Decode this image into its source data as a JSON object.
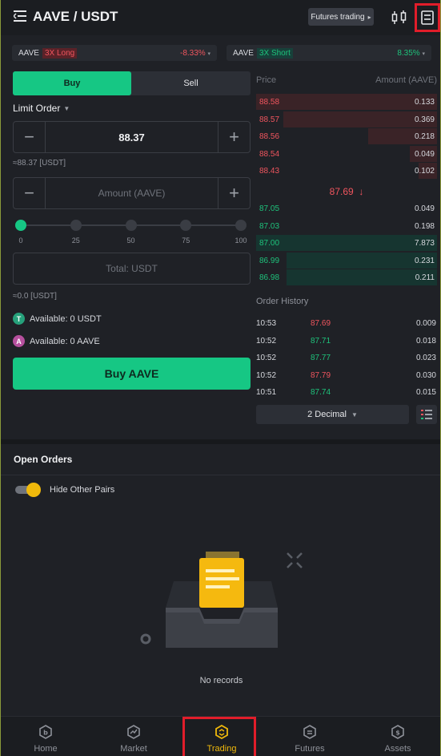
{
  "header": {
    "title": "AAVE / USDT",
    "futures_label": "Futures trading"
  },
  "leverage": [
    {
      "symbol": "AAVE",
      "tag": "3X Long",
      "change": "-8.33%"
    },
    {
      "symbol": "AAVE",
      "tag": "3X Short",
      "change": "8.35%"
    }
  ],
  "form": {
    "buy_tab": "Buy",
    "sell_tab": "Sell",
    "order_type": "Limit Order",
    "price_value": "88.37",
    "price_hint": "≈88.37 [USDT]",
    "amount_placeholder": "Amount (AAVE)",
    "slider_labels": [
      "0",
      "25",
      "50",
      "75",
      "100"
    ],
    "slider_value_percent": 0,
    "total_placeholder": "Total: USDT",
    "total_hint": "≈0.0 [USDT]",
    "available_usdt": "Available: 0 USDT",
    "available_aave": "Available: 0 AAVE",
    "buy_button": "Buy AAVE"
  },
  "orderbook": {
    "price_header": "Price",
    "amount_header": "Amount (AAVE)",
    "asks": [
      {
        "price": "88.58",
        "amount": "0.133",
        "depth": 1.0
      },
      {
        "price": "88.57",
        "amount": "0.369",
        "depth": 0.85
      },
      {
        "price": "88.56",
        "amount": "0.218",
        "depth": 0.38
      },
      {
        "price": "88.54",
        "amount": "0.049",
        "depth": 0.15
      },
      {
        "price": "88.43",
        "amount": "0.102",
        "depth": 0.1
      }
    ],
    "last_price": "87.69",
    "last_arrow": "↓",
    "bids": [
      {
        "price": "87.05",
        "amount": "0.049",
        "depth": 0.0
      },
      {
        "price": "87.03",
        "amount": "0.198",
        "depth": 0.0
      },
      {
        "price": "87.00",
        "amount": "7.873",
        "depth": 1.0
      },
      {
        "price": "86.99",
        "amount": "0.231",
        "depth": 0.83
      },
      {
        "price": "86.98",
        "amount": "0.211",
        "depth": 0.83
      }
    ]
  },
  "history": {
    "title": "Order History",
    "rows": [
      {
        "time": "10:53",
        "price": "87.69",
        "dir": "down",
        "amount": "0.009"
      },
      {
        "time": "10:52",
        "price": "87.71",
        "dir": "up",
        "amount": "0.018"
      },
      {
        "time": "10:52",
        "price": "87.77",
        "dir": "up",
        "amount": "0.023"
      },
      {
        "time": "10:52",
        "price": "87.79",
        "dir": "down",
        "amount": "0.030"
      },
      {
        "time": "10:51",
        "price": "87.74",
        "dir": "up",
        "amount": "0.015"
      }
    ],
    "decimal_label": "2 Decimal"
  },
  "open_orders": {
    "title": "Open Orders",
    "hide_label": "Hide Other Pairs",
    "empty_text": "No records"
  },
  "nav": {
    "items": [
      {
        "label": "Home",
        "icon": "home-icon"
      },
      {
        "label": "Market",
        "icon": "market-icon"
      },
      {
        "label": "Trading",
        "icon": "trading-icon"
      },
      {
        "label": "Futures",
        "icon": "futures-icon"
      },
      {
        "label": "Assets",
        "icon": "assets-icon"
      }
    ],
    "active": "Trading"
  },
  "colors": {
    "accent_green": "#16c784",
    "accent_red": "#f0555e",
    "active_yellow": "#f0b90b",
    "highlight_red": "#e11d2a"
  }
}
